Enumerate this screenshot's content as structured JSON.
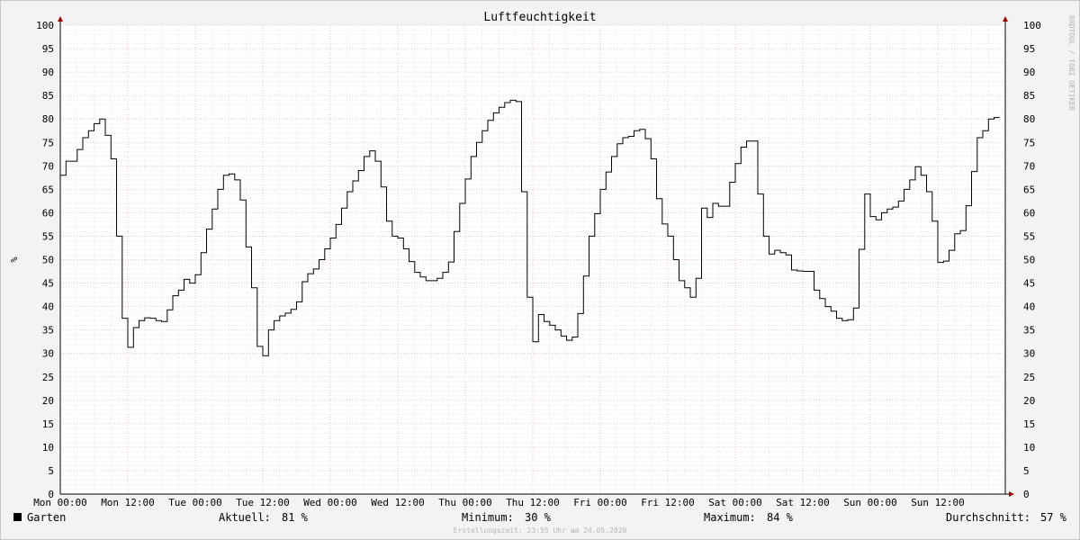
{
  "chart_data": {
    "type": "line",
    "title": "Luftfeuchtigkeit",
    "ylabel": "%",
    "ylim": [
      0,
      100
    ],
    "y_ticks": [
      0,
      5,
      10,
      15,
      20,
      25,
      30,
      35,
      40,
      45,
      50,
      55,
      60,
      65,
      70,
      75,
      80,
      85,
      90,
      95,
      100
    ],
    "x_tick_labels": [
      "Mon 00:00",
      "Mon 12:00",
      "Tue 00:00",
      "Tue 12:00",
      "Wed 00:00",
      "Wed 12:00",
      "Thu 00:00",
      "Thu 12:00",
      "Fri 00:00",
      "Fri 12:00",
      "Sat 00:00",
      "Sat 12:00",
      "Sun 00:00",
      "Sun 12:00"
    ],
    "grid": true,
    "watermark": "RRDTOOL / TOBI OETIKER",
    "series": [
      {
        "name": "Garten",
        "color": "#000000",
        "x_hours": [
          0,
          1,
          2,
          3,
          4,
          5,
          6,
          7,
          8,
          9,
          10,
          11,
          12,
          13,
          14,
          15,
          16,
          17,
          18,
          19,
          20,
          21,
          22,
          23,
          24,
          25,
          26,
          27,
          28,
          29,
          30,
          31,
          32,
          33,
          34,
          35,
          36,
          37,
          38,
          39,
          40,
          41,
          42,
          43,
          44,
          45,
          46,
          47,
          48,
          49,
          50,
          51,
          52,
          53,
          54,
          55,
          56,
          57,
          58,
          59,
          60,
          61,
          62,
          63,
          64,
          65,
          66,
          67,
          68,
          69,
          70,
          71,
          72,
          73,
          74,
          75,
          76,
          77,
          78,
          79,
          80,
          81,
          82,
          83,
          84,
          85,
          86,
          87,
          88,
          89,
          90,
          91,
          92,
          93,
          94,
          95,
          96,
          97,
          98,
          99,
          100,
          101,
          102,
          103,
          104,
          105,
          106,
          107,
          108,
          109,
          110,
          111,
          112,
          113,
          114,
          115,
          116,
          117,
          118,
          119,
          120,
          121,
          122,
          123,
          124,
          125,
          126,
          127,
          128,
          129,
          130,
          131,
          132,
          133,
          134,
          135,
          136,
          137,
          138,
          139,
          140,
          141,
          142,
          143,
          144,
          145,
          146,
          147,
          148,
          149,
          150,
          151,
          152,
          153,
          154,
          155,
          156,
          157,
          158,
          159,
          160,
          161,
          162,
          163,
          164,
          165,
          166
        ],
        "values": [
          68,
          71,
          71,
          73.5,
          76,
          77.5,
          79,
          80,
          76.5,
          71.5,
          55,
          37.5,
          31.3,
          35.5,
          37,
          37.6,
          37.5,
          37,
          36.8,
          39.3,
          42.3,
          43.5,
          45.8,
          45,
          46.8,
          51.5,
          56.5,
          60.8,
          65,
          68,
          68.3,
          67,
          62.7,
          52.7,
          44,
          31.5,
          29.5,
          35,
          37,
          38,
          38.6,
          39.4,
          41,
          45.3,
          47,
          48,
          50,
          52.3,
          54.6,
          57.5,
          61,
          64.5,
          66.8,
          69,
          72,
          73.2,
          71,
          65.5,
          58.2,
          55,
          54.6,
          52.3,
          49.6,
          47.3,
          46.3,
          45.5,
          45.5,
          46,
          47.3,
          49.5,
          56,
          62,
          67.2,
          72,
          75,
          77.5,
          79.7,
          81.3,
          82.5,
          83.5,
          84,
          83.7,
          64.5,
          42,
          32.5,
          38.3,
          36.8,
          36,
          35,
          33.7,
          32.8,
          33.5,
          38.5,
          46.5,
          55,
          59.8,
          65,
          68.7,
          72,
          74.7,
          76,
          76.3,
          77.5,
          77.8,
          75.8,
          71.5,
          63,
          57.6,
          55,
          50,
          45.5,
          44,
          42,
          46,
          61,
          59,
          62,
          61.4,
          61.4,
          66.5,
          70.5,
          74,
          75.3,
          75.3,
          64,
          55,
          51.2,
          52,
          51.5,
          51,
          47.8,
          47.6,
          47.5,
          47.5,
          43.5,
          41.7,
          40,
          39,
          37.5,
          37,
          37.2,
          39.7,
          52.2,
          64,
          59.2,
          58.5,
          60,
          60.8,
          61.2,
          62.5,
          65,
          67,
          69.8,
          68,
          64.5,
          58.2,
          49.4,
          49.7,
          52,
          55.5,
          56.2,
          61.5,
          68.8,
          76,
          77.5,
          80,
          80.3,
          80.2,
          81
        ]
      }
    ]
  },
  "legend": {
    "series_label": "Garten",
    "current_label": "Aktuell:",
    "current_value": "81 %",
    "min_label": "Minimum:",
    "min_value": "30 %",
    "max_label": "Maximum:",
    "max_value": "84 %",
    "avg_label": "Durchschnitt:",
    "avg_value": "57 %"
  },
  "footer": "Erstellungszeit: 23:55 Uhr am 24.05.2020"
}
